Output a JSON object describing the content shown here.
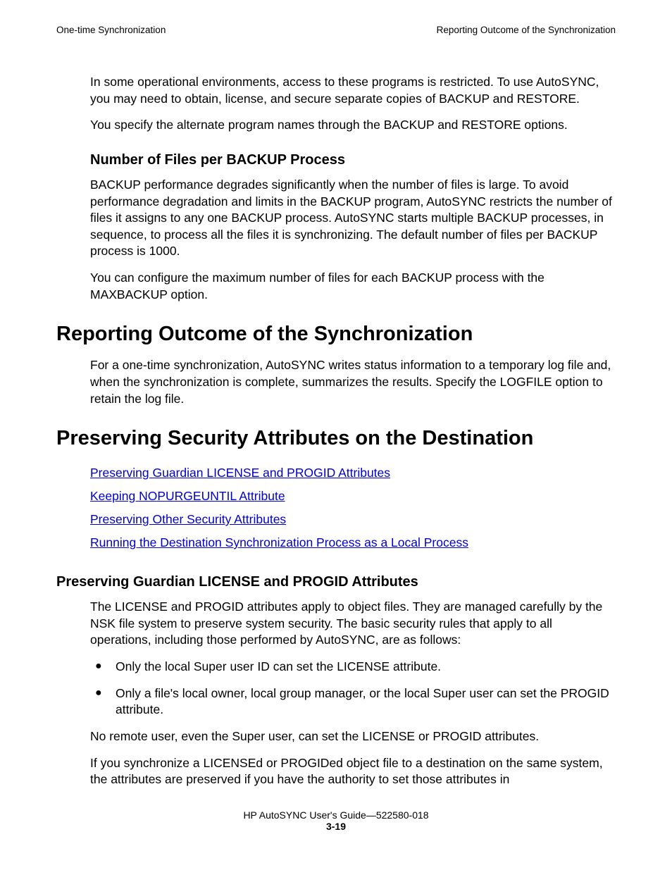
{
  "header": {
    "left": "One-time Synchronization",
    "right": "Reporting Outcome of the Synchronization"
  },
  "intro": {
    "p1": "In some operational environments, access to these programs is restricted. To use AutoSYNC, you may need to obtain, license, and secure separate copies of BACKUP and RESTORE.",
    "p2": "You specify the alternate program names through the BACKUP and RESTORE options."
  },
  "numFiles": {
    "heading": "Number of Files per BACKUP Process",
    "p1": "BACKUP performance degrades significantly when the number of files is large. To avoid performance degradation and limits in the BACKUP program, AutoSYNC restricts the number of files it assigns to any one BACKUP process. AutoSYNC starts multiple BACKUP processes, in sequence, to process all the files it is synchronizing. The default number of files per BACKUP process is 1000.",
    "p2": "You can configure the maximum number of files for each BACKUP process with the MAXBACKUP option."
  },
  "reporting": {
    "heading": "Reporting Outcome of the Synchronization",
    "p1": "For a one-time synchronization, AutoSYNC writes status information to a temporary log file and, when the synchronization is complete, summarizes the results. Specify the LOGFILE option to retain the log file."
  },
  "preserving": {
    "heading": "Preserving Security Attributes on the Destination",
    "links": [
      "Preserving Guardian LICENSE and PROGID Attributes",
      "Keeping NOPURGEUNTIL Attribute",
      "Preserving Other Security Attributes",
      "Running the Destination Synchronization Process as a Local Process"
    ]
  },
  "guardian": {
    "heading": "Preserving Guardian LICENSE and PROGID Attributes",
    "p1": "The LICENSE and PROGID attributes apply to object files. They are managed carefully by the NSK file system to preserve system security. The basic security rules that apply to all operations, including those performed by AutoSYNC, are as follows:",
    "bullets": [
      "Only the local Super user ID can set the LICENSE attribute.",
      "Only a file's local owner, local group manager, or the local Super user can set the PROGID attribute."
    ],
    "p2": "No remote user, even the Super user, can set the LICENSE or PROGID attributes.",
    "p3": "If you synchronize a LICENSEd or PROGIDed object file to a destination on the same system, the attributes are preserved if you have the authority to set those attributes in"
  },
  "footer": {
    "line1": "HP AutoSYNC User's Guide—522580-018",
    "pagenum": "3-19"
  }
}
